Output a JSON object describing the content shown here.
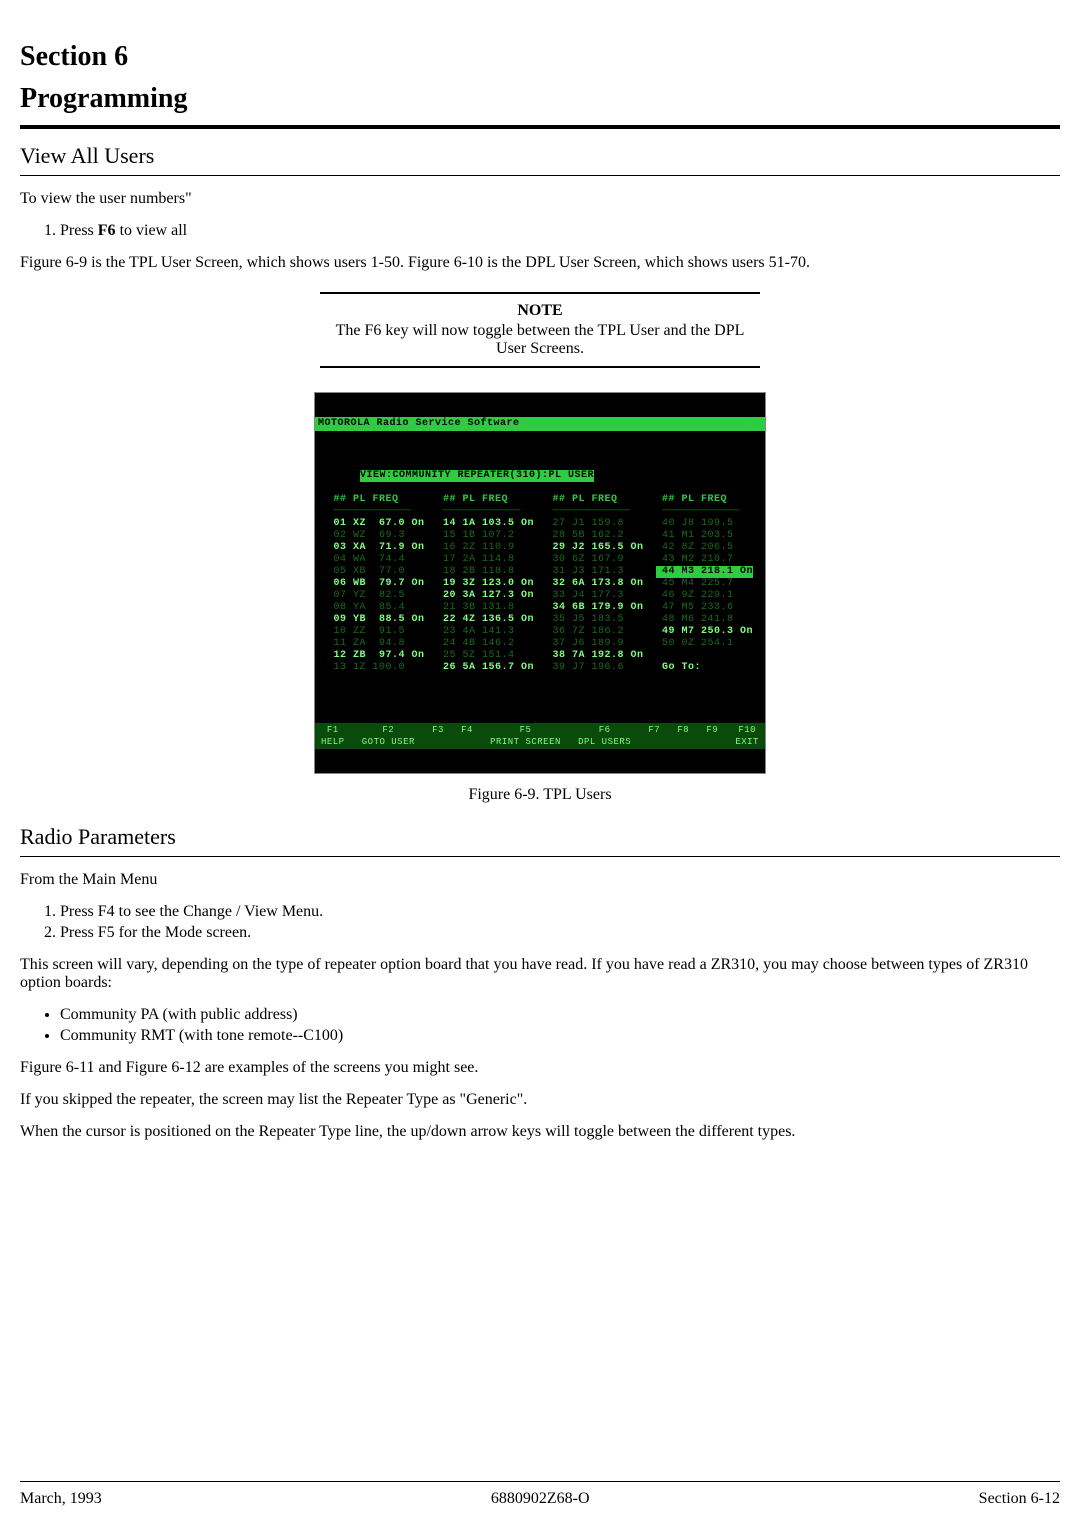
{
  "title_line1": "Section 6",
  "title_line2": "Programming",
  "view_users": {
    "heading": "View All Users",
    "intro": "To view the user numbers\"",
    "step1": "Press F6 to view all",
    "fig_sentence": "Figure 6-9 is the TPL User Screen, which shows users 1-50. Figure 6-10 is the DPL User Screen, which shows users 51-70.",
    "note_title": "NOTE",
    "note_body": "The F6 key will now toggle between the TPL User and the DPL User Screens."
  },
  "figure": {
    "caption": "Figure 6-9. TPL Users",
    "term_title": "MOTOROLA Radio Service Software",
    "term_sub": "VIEW:COMMUNITY REPEATER(310):PL USER",
    "col_header": "## PL FREQ",
    "goto_label": "Go To:",
    "cols": [
      [
        {
          "n": "01",
          "pl": "XZ",
          "f": "67.0",
          "on": true,
          "hi": true
        },
        {
          "n": "02",
          "pl": "WZ",
          "f": "69.3",
          "on": false,
          "hi": false
        },
        {
          "n": "03",
          "pl": "XA",
          "f": "71.9",
          "on": true,
          "hi": true
        },
        {
          "n": "04",
          "pl": "WA",
          "f": "74.4",
          "on": false,
          "hi": false
        },
        {
          "n": "05",
          "pl": "XB",
          "f": "77.0",
          "on": false,
          "hi": false
        },
        {
          "n": "06",
          "pl": "WB",
          "f": "79.7",
          "on": true,
          "hi": true
        },
        {
          "n": "07",
          "pl": "YZ",
          "f": "82.5",
          "on": false,
          "hi": false
        },
        {
          "n": "08",
          "pl": "YA",
          "f": "85.4",
          "on": false,
          "hi": false
        },
        {
          "n": "09",
          "pl": "YB",
          "f": "88.5",
          "on": true,
          "hi": true
        },
        {
          "n": "10",
          "pl": "ZZ",
          "f": "91.5",
          "on": false,
          "hi": false
        },
        {
          "n": "11",
          "pl": "ZA",
          "f": "94.8",
          "on": false,
          "hi": false
        },
        {
          "n": "12",
          "pl": "ZB",
          "f": "97.4",
          "on": true,
          "hi": true
        },
        {
          "n": "13",
          "pl": "1Z",
          "f": "100.0",
          "on": false,
          "hi": false
        }
      ],
      [
        {
          "n": "14",
          "pl": "1A",
          "f": "103.5",
          "on": true,
          "hi": true
        },
        {
          "n": "15",
          "pl": "1B",
          "f": "107.2",
          "on": false,
          "hi": false
        },
        {
          "n": "16",
          "pl": "2Z",
          "f": "110.9",
          "on": false,
          "hi": false
        },
        {
          "n": "17",
          "pl": "2A",
          "f": "114.8",
          "on": false,
          "hi": false
        },
        {
          "n": "18",
          "pl": "2B",
          "f": "118.8",
          "on": false,
          "hi": false
        },
        {
          "n": "19",
          "pl": "3Z",
          "f": "123.0",
          "on": true,
          "hi": true
        },
        {
          "n": "20",
          "pl": "3A",
          "f": "127.3",
          "on": true,
          "hi": true
        },
        {
          "n": "21",
          "pl": "3B",
          "f": "131.8",
          "on": false,
          "hi": false
        },
        {
          "n": "22",
          "pl": "4Z",
          "f": "136.5",
          "on": true,
          "hi": true
        },
        {
          "n": "23",
          "pl": "4A",
          "f": "141.3",
          "on": false,
          "hi": false
        },
        {
          "n": "24",
          "pl": "4B",
          "f": "146.2",
          "on": false,
          "hi": false
        },
        {
          "n": "25",
          "pl": "5Z",
          "f": "151.4",
          "on": false,
          "hi": false
        },
        {
          "n": "26",
          "pl": "5A",
          "f": "156.7",
          "on": true,
          "hi": true
        }
      ],
      [
        {
          "n": "27",
          "pl": "J1",
          "f": "159.8",
          "on": false,
          "hi": false
        },
        {
          "n": "28",
          "pl": "5B",
          "f": "162.2",
          "on": false,
          "hi": false
        },
        {
          "n": "29",
          "pl": "J2",
          "f": "165.5",
          "on": true,
          "hi": true
        },
        {
          "n": "30",
          "pl": "6Z",
          "f": "167.9",
          "on": false,
          "hi": false
        },
        {
          "n": "31",
          "pl": "J3",
          "f": "171.3",
          "on": false,
          "hi": false
        },
        {
          "n": "32",
          "pl": "6A",
          "f": "173.8",
          "on": true,
          "hi": true
        },
        {
          "n": "33",
          "pl": "J4",
          "f": "177.3",
          "on": false,
          "hi": false
        },
        {
          "n": "34",
          "pl": "6B",
          "f": "179.9",
          "on": true,
          "hi": true
        },
        {
          "n": "35",
          "pl": "J5",
          "f": "183.5",
          "on": false,
          "hi": false
        },
        {
          "n": "36",
          "pl": "7Z",
          "f": "186.2",
          "on": false,
          "hi": false
        },
        {
          "n": "37",
          "pl": "J6",
          "f": "189.9",
          "on": false,
          "hi": false
        },
        {
          "n": "38",
          "pl": "7A",
          "f": "192.8",
          "on": true,
          "hi": true
        },
        {
          "n": "39",
          "pl": "J7",
          "f": "196.6",
          "on": false,
          "hi": false
        }
      ],
      [
        {
          "n": "40",
          "pl": "J8",
          "f": "199.5",
          "on": false,
          "hi": false
        },
        {
          "n": "41",
          "pl": "M1",
          "f": "203.5",
          "on": false,
          "hi": false
        },
        {
          "n": "42",
          "pl": "8Z",
          "f": "206.5",
          "on": false,
          "hi": false
        },
        {
          "n": "43",
          "pl": "M2",
          "f": "210.7",
          "on": false,
          "hi": false
        },
        {
          "n": "44",
          "pl": "M3",
          "f": "218.1",
          "on": true,
          "hi": true,
          "cursor": true
        },
        {
          "n": "45",
          "pl": "M4",
          "f": "225.7",
          "on": false,
          "hi": false
        },
        {
          "n": "46",
          "pl": "9Z",
          "f": "229.1",
          "on": false,
          "hi": false
        },
        {
          "n": "47",
          "pl": "M5",
          "f": "233.6",
          "on": false,
          "hi": false
        },
        {
          "n": "48",
          "pl": "M6",
          "f": "241.8",
          "on": false,
          "hi": false
        },
        {
          "n": "49",
          "pl": "M7",
          "f": "250.3",
          "on": true,
          "hi": true
        },
        {
          "n": "50",
          "pl": "0Z",
          "f": "254.1",
          "on": false,
          "hi": false
        }
      ]
    ],
    "funcbar": [
      {
        "k": "F1",
        "l": "HELP"
      },
      {
        "k": "F2",
        "l": "GOTO USER"
      },
      {
        "k": "F3",
        "l": ""
      },
      {
        "k": "F4",
        "l": ""
      },
      {
        "k": "F5",
        "l": "PRINT SCREEN"
      },
      {
        "k": "F6",
        "l": "DPL USERS"
      },
      {
        "k": "F7",
        "l": ""
      },
      {
        "k": "F8",
        "l": ""
      },
      {
        "k": "F9",
        "l": ""
      },
      {
        "k": "F10",
        "l": "EXIT"
      }
    ]
  },
  "radio_params": {
    "heading": "Radio Parameters",
    "intro": "From the Main Menu",
    "step1": "Press F4 to see the Change / View Menu.",
    "step2": "Press F5 for the Mode screen.",
    "para1": "This screen will vary, depending on the type of repeater option board that you have read. If you have read a ZR310, you may choose between types of ZR310 option boards:",
    "bullet1": "Community PA (with public address)",
    "bullet2": "Community RMT (with tone remote--C100)",
    "para_examples": "Figure 6-11 and Figure 6-12 are examples of the screens you might see.",
    "para_skipped": "If you skipped the repeater, the screen may list the Repeater Type as \"Generic\".",
    "para_cursor": "When the cursor is positioned on the Repeater Type line, the up/down arrow keys will toggle between the different types."
  },
  "footer": {
    "left": "March, 1993",
    "center": "6880902Z68-O",
    "right": "Section 6-12"
  },
  "bold_f6": "F6"
}
